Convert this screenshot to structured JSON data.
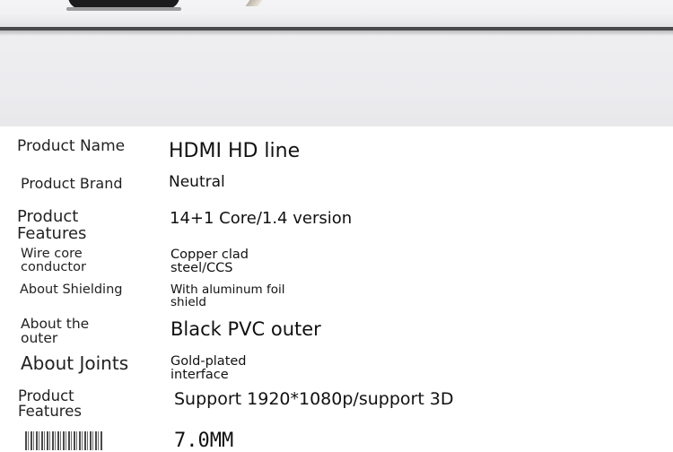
{
  "specs": [
    {
      "label": "Product Name",
      "value": "HDMI HD line"
    },
    {
      "label": "Product Brand",
      "value": "Neutral"
    },
    {
      "label": "Product Features",
      "value": "14+1 Core/1.4 version"
    },
    {
      "label": "Wire core conductor",
      "value": "Copper clad steel/CCS"
    },
    {
      "label": "About Shielding",
      "value": "With aluminum foil shield"
    },
    {
      "label": "About the outer",
      "value": "Black PVC outer"
    },
    {
      "label": "About Joints",
      "value": "Gold-plated interface"
    },
    {
      "label": "Product Features",
      "value": "Support 1920*1080p/support 3D"
    },
    {
      "label": "",
      "value": "7.0MM"
    }
  ]
}
